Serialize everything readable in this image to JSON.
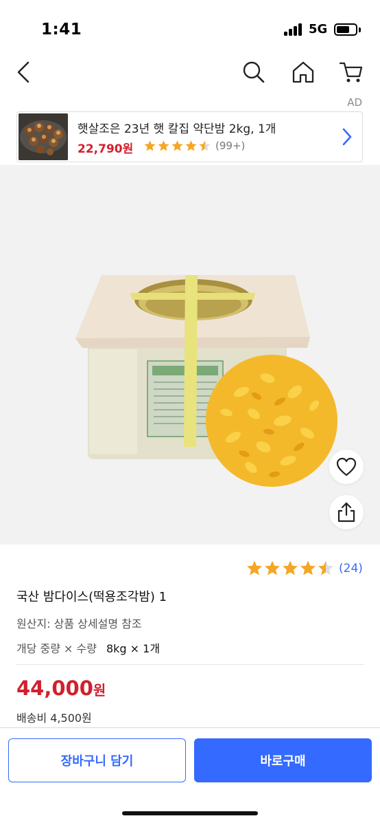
{
  "status_bar": {
    "time": "1:41",
    "network": "5G",
    "battery_level": 0.7
  },
  "nav": {
    "icons": [
      "back-icon",
      "search-icon",
      "home-icon",
      "cart-icon"
    ]
  },
  "ad": {
    "label": "AD",
    "title": "햇살조은 23년 햇 칼집 약단밤 2kg, 1개",
    "price": "22,790원",
    "rating": 4.5,
    "review_count": "(99+)"
  },
  "product": {
    "rating": 4.5,
    "review_count": "(24)",
    "name": "국산 밤다이스(떡용조각밤) 1",
    "origin": "원산지: 상품 상세설명 참조",
    "option_label": "개당 중량 × 수량",
    "option_value": "8kg × 1개",
    "price_number": "44,000",
    "price_unit": "원",
    "shipping": "배송비 4,500원"
  },
  "actions": {
    "add_to_cart": "장바구니 담기",
    "buy_now": "바로구매"
  },
  "colors": {
    "accent": "#346aff",
    "price_red": "#d0202e",
    "star": "#f5a623"
  }
}
